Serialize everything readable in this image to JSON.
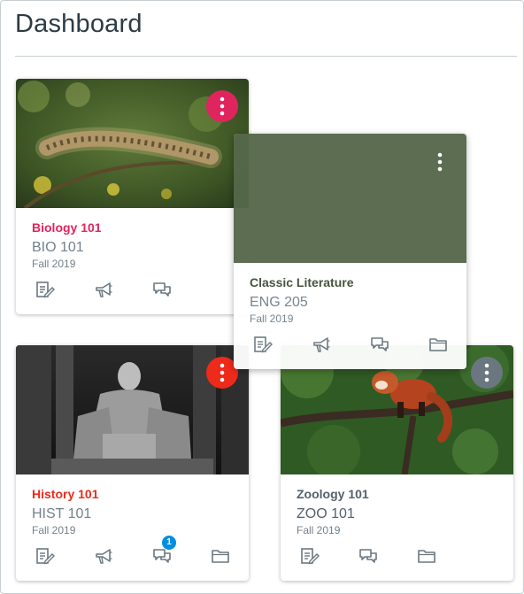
{
  "page": {
    "title": "Dashboard"
  },
  "colors": {
    "biology": "#e0245e",
    "literature": "#56684a",
    "history": "#ee2a1a",
    "zoology": "#6b7780",
    "badge": "#008ee2",
    "icon": "#6b7780"
  },
  "cards": [
    {
      "name": "Biology 101",
      "code": "BIO 101",
      "term": "Fall 2019",
      "hero": "caterpillar photo",
      "actions": [
        "assignments-icon",
        "announcements-icon",
        "discussions-icon"
      ]
    },
    {
      "name": "Classic Literature",
      "code": "ENG 205",
      "term": "Fall 2019",
      "hero": "solid green color",
      "actions": [
        "assignments-icon",
        "announcements-icon",
        "discussions-icon",
        "files-icon"
      ]
    },
    {
      "name": "History 101",
      "code": "HIST 101",
      "term": "Fall 2019",
      "hero": "Lincoln memorial statue photo",
      "discussion_badge": "1",
      "actions": [
        "assignments-icon",
        "announcements-icon",
        "discussions-icon",
        "files-icon"
      ]
    },
    {
      "name": "Zoology 101",
      "code": "ZOO 101",
      "term": "Fall 2019",
      "hero": "red panda photo",
      "actions": [
        "assignments-icon",
        "discussions-icon",
        "files-icon"
      ]
    }
  ]
}
